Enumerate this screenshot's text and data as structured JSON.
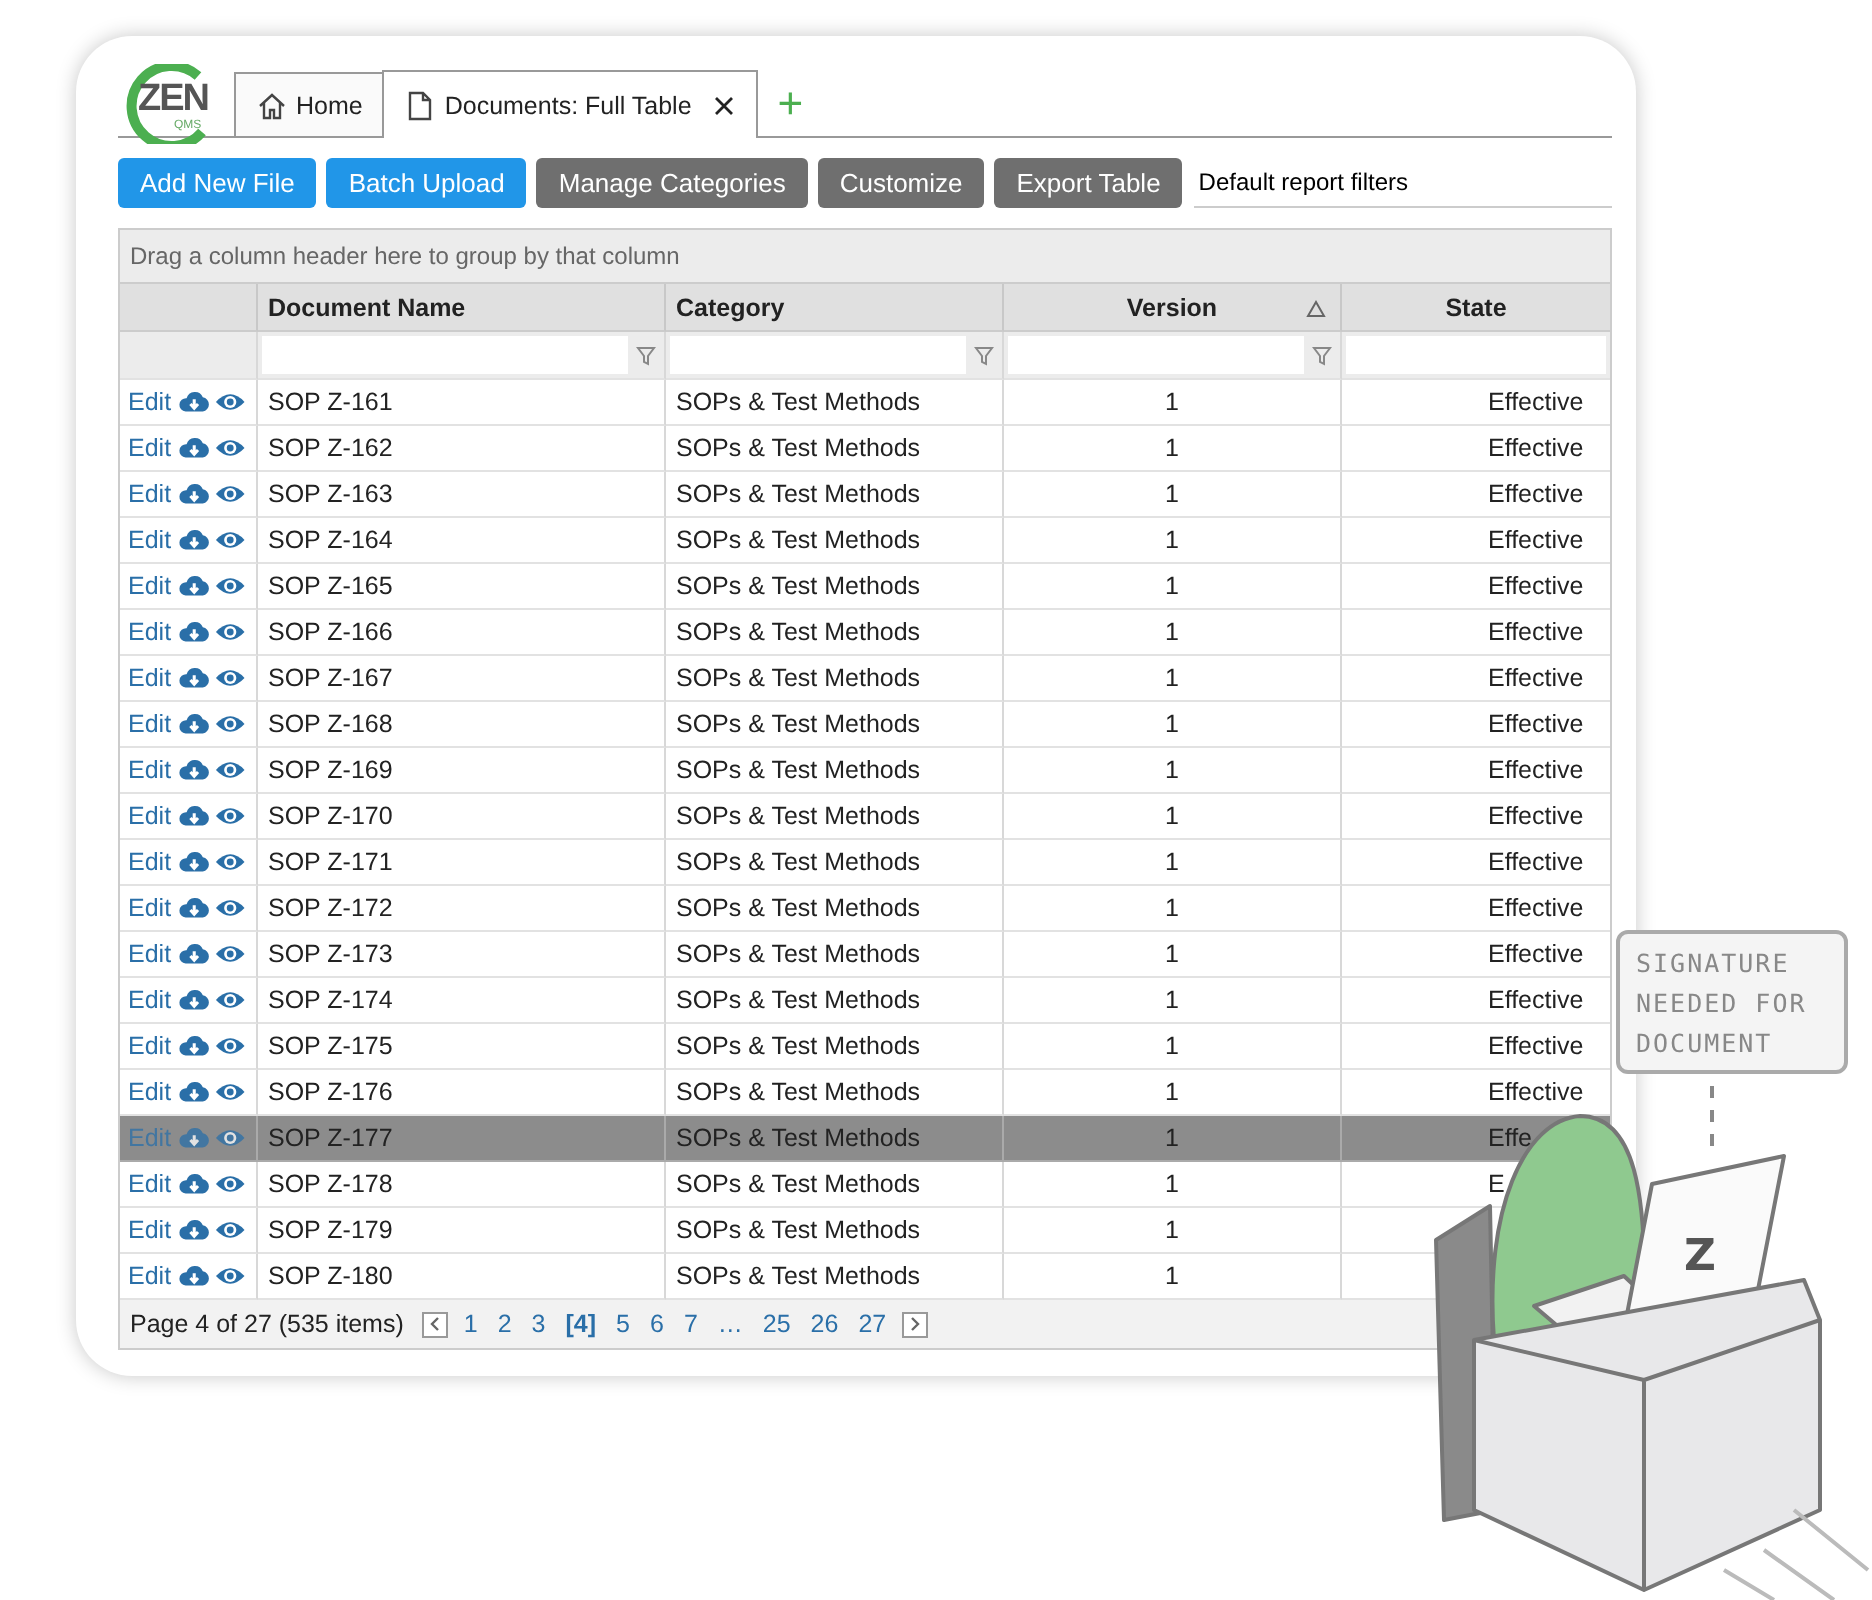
{
  "logo": {
    "text": "ZEN",
    "subtext": "QMS"
  },
  "tabs": [
    {
      "label": "Home",
      "closable": false,
      "selected": false
    },
    {
      "label": "Documents: Full Table",
      "closable": true,
      "selected": true
    }
  ],
  "new_tab": "+",
  "toolbar": {
    "buttons": [
      {
        "label": "Add New File",
        "kind": "primary"
      },
      {
        "label": "Batch Upload",
        "kind": "primary"
      },
      {
        "label": "Manage Categories",
        "kind": "secondary"
      },
      {
        "label": "Customize",
        "kind": "secondary"
      },
      {
        "label": "Export Table",
        "kind": "secondary"
      }
    ],
    "filter_field": {
      "value": "Default report filters"
    }
  },
  "table": {
    "group_panel": "Drag a column header here to group by that column",
    "columns": [
      {
        "label": "Document Name",
        "sorted": false,
        "filter_icon": true
      },
      {
        "label": "Category",
        "sorted": false,
        "filter_icon": true
      },
      {
        "label": "Version",
        "sorted": true,
        "filter_icon": true
      },
      {
        "label": "State",
        "sorted": false,
        "filter_icon": false
      }
    ],
    "rows": [
      {
        "action": "Edit",
        "name": "SOP Z-161",
        "category": "SOPs & Test Methods",
        "version": "1",
        "state": "Effective",
        "selected": false
      },
      {
        "action": "Edit",
        "name": "SOP Z-162",
        "category": "SOPs & Test Methods",
        "version": "1",
        "state": "Effective",
        "selected": false
      },
      {
        "action": "Edit",
        "name": "SOP Z-163",
        "category": "SOPs & Test Methods",
        "version": "1",
        "state": "Effective",
        "selected": false
      },
      {
        "action": "Edit",
        "name": "SOP Z-164",
        "category": "SOPs & Test Methods",
        "version": "1",
        "state": "Effective",
        "selected": false
      },
      {
        "action": "Edit",
        "name": "SOP Z-165",
        "category": "SOPs & Test Methods",
        "version": "1",
        "state": "Effective",
        "selected": false
      },
      {
        "action": "Edit",
        "name": "SOP Z-166",
        "category": "SOPs & Test Methods",
        "version": "1",
        "state": "Effective",
        "selected": false
      },
      {
        "action": "Edit",
        "name": "SOP Z-167",
        "category": "SOPs & Test Methods",
        "version": "1",
        "state": "Effective",
        "selected": false
      },
      {
        "action": "Edit",
        "name": "SOP Z-168",
        "category": "SOPs & Test Methods",
        "version": "1",
        "state": "Effective",
        "selected": false
      },
      {
        "action": "Edit",
        "name": "SOP Z-169",
        "category": "SOPs & Test Methods",
        "version": "1",
        "state": "Effective",
        "selected": false
      },
      {
        "action": "Edit",
        "name": "SOP Z-170",
        "category": "SOPs & Test Methods",
        "version": "1",
        "state": "Effective",
        "selected": false
      },
      {
        "action": "Edit",
        "name": "SOP Z-171",
        "category": "SOPs & Test Methods",
        "version": "1",
        "state": "Effective",
        "selected": false
      },
      {
        "action": "Edit",
        "name": "SOP Z-172",
        "category": "SOPs & Test Methods",
        "version": "1",
        "state": "Effective",
        "selected": false
      },
      {
        "action": "Edit",
        "name": "SOP Z-173",
        "category": "SOPs & Test Methods",
        "version": "1",
        "state": "Effective",
        "selected": false
      },
      {
        "action": "Edit",
        "name": "SOP Z-174",
        "category": "SOPs & Test Methods",
        "version": "1",
        "state": "Effective",
        "selected": false
      },
      {
        "action": "Edit",
        "name": "SOP Z-175",
        "category": "SOPs & Test Methods",
        "version": "1",
        "state": "Effective",
        "selected": false
      },
      {
        "action": "Edit",
        "name": "SOP Z-176",
        "category": "SOPs & Test Methods",
        "version": "1",
        "state": "Effective",
        "selected": false
      },
      {
        "action": "Edit",
        "name": "SOP Z-177",
        "category": "SOPs & Test Methods",
        "version": "1",
        "state": "Effe",
        "selected": true
      },
      {
        "action": "Edit",
        "name": "SOP Z-178",
        "category": "SOPs & Test Methods",
        "version": "1",
        "state": "E",
        "selected": false
      },
      {
        "action": "Edit",
        "name": "SOP Z-179",
        "category": "SOPs & Test Methods",
        "version": "1",
        "selected": false
      },
      {
        "action": "Edit",
        "name": "SOP Z-180",
        "category": "SOPs & Test Methods",
        "version": "1",
        "selected": false
      }
    ]
  },
  "pager": {
    "summary": "Page 4 of 27 (535 items)",
    "pages": [
      {
        "label": "1",
        "selected": false
      },
      {
        "label": "2",
        "selected": false
      },
      {
        "label": "3",
        "selected": false
      },
      {
        "label": "[4]",
        "selected": true
      },
      {
        "label": "5",
        "selected": false
      },
      {
        "label": "6",
        "selected": false
      },
      {
        "label": "7",
        "selected": false
      },
      {
        "label": "…",
        "selected": false
      },
      {
        "label": "25",
        "selected": false
      },
      {
        "label": "26",
        "selected": false
      },
      {
        "label": "27",
        "selected": false
      }
    ]
  },
  "illustration": {
    "speech_bubble": "SIGNATURE NEEDED FOR DOCUMENT",
    "laptop_mark": "Z"
  }
}
